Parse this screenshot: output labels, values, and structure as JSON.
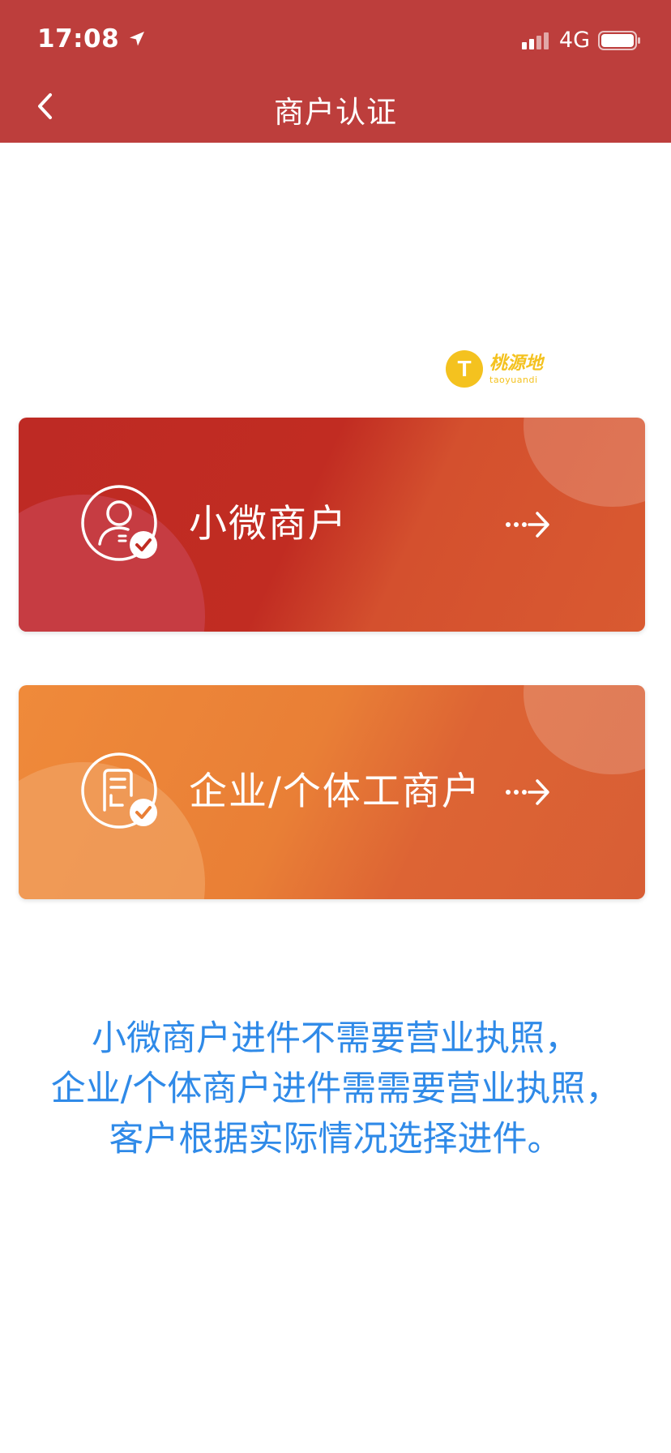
{
  "status_bar": {
    "time": "17:08",
    "network": "4G"
  },
  "nav": {
    "title": "商户认证"
  },
  "watermark": {
    "logo_letter": "T",
    "text_cn": "桃源地",
    "text_en": "taoyuandi"
  },
  "cards": [
    {
      "label": "小微商户",
      "icon": "merchant-person-icon"
    },
    {
      "label": "企业/个体工商户",
      "icon": "business-license-icon"
    }
  ],
  "info": {
    "lines": [
      "小微商户进件不需要营业执照，",
      "企业/个体商户进件需需要营业执照，",
      "客户根据实际情况选择进件。"
    ]
  },
  "colors": {
    "header": "#bd3e3c",
    "card_micro": "#c12c22",
    "card_enterprise": "#e97f36",
    "info_text": "#2f8ae8",
    "watermark": "#f4c21f"
  }
}
